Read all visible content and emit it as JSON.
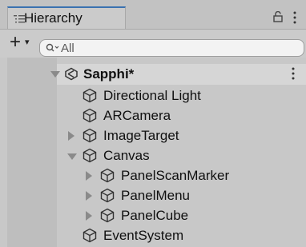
{
  "window": {
    "tab_label": "Hierarchy",
    "tab_icon": "hierarchy-list-icon",
    "lock_icon": "lock-icon",
    "menu_icon": "kebab-menu-icon"
  },
  "toolbar": {
    "add_label": "+",
    "add_caret": "▾",
    "search": {
      "placeholder": "All",
      "value": ""
    }
  },
  "scene": {
    "name": "Sapphi*",
    "icon": "unity-scene-icon",
    "expanded": true
  },
  "items": [
    {
      "label": "Directional Light",
      "icon": "gameobject-cube-icon",
      "depth": 1,
      "foldout": "none"
    },
    {
      "label": "ARCamera",
      "icon": "gameobject-cube-icon",
      "depth": 1,
      "foldout": "none"
    },
    {
      "label": "ImageTarget",
      "icon": "gameobject-cube-icon",
      "depth": 1,
      "foldout": "collapsed"
    },
    {
      "label": "Canvas",
      "icon": "gameobject-cube-icon",
      "depth": 1,
      "foldout": "expanded"
    },
    {
      "label": "PanelScanMarker",
      "icon": "gameobject-cube-icon",
      "depth": 2,
      "foldout": "collapsed"
    },
    {
      "label": "PanelMenu",
      "icon": "gameobject-cube-icon",
      "depth": 2,
      "foldout": "collapsed"
    },
    {
      "label": "PanelCube",
      "icon": "gameobject-cube-icon",
      "depth": 2,
      "foldout": "collapsed"
    },
    {
      "label": "EventSystem",
      "icon": "gameobject-cube-icon",
      "depth": 1,
      "foldout": "none"
    }
  ],
  "colors": {
    "accent_tab": "#3a72b0",
    "panel_bg": "#c8c8c8",
    "selected_scene_row": "#d6d6d6"
  }
}
